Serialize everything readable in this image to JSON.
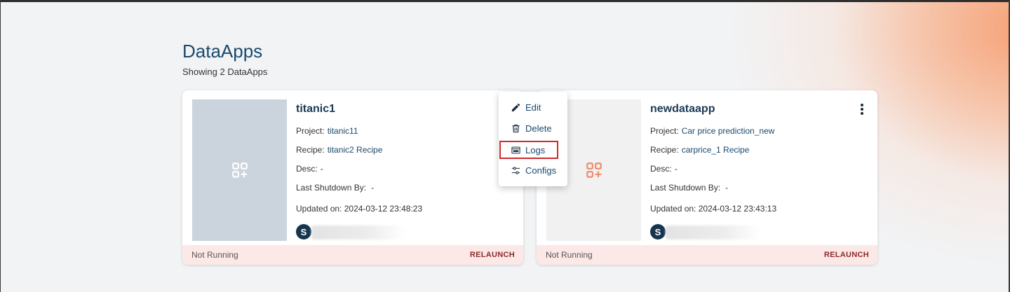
{
  "page": {
    "title": "DataApps",
    "subtitle": "Showing 2 DataApps"
  },
  "cards": [
    {
      "title": "titanic1",
      "project_label": "Project:",
      "project_value": "titanic11",
      "recipe_label": "Recipe:",
      "recipe_value": "titanic2 Recipe",
      "desc_label": "Desc:",
      "desc_value": "-",
      "shutdown_label": "Last Shutdown By:",
      "shutdown_value": "-",
      "updated": "Updated on: 2024-03-12 23:48:23",
      "avatar_letter": "S",
      "status": "Not Running",
      "action": "RELAUNCH",
      "icon": "apps-add-icon",
      "icon_color": "#ffffff"
    },
    {
      "title": "newdataapp",
      "project_label": "Project:",
      "project_value": "Car price prediction_new",
      "recipe_label": "Recipe:",
      "recipe_value": "carprice_1 Recipe",
      "desc_label": "Desc:",
      "desc_value": "-",
      "shutdown_label": "Last Shutdown By:",
      "shutdown_value": "-",
      "updated": "Updated on: 2024-03-12 23:43:13",
      "avatar_letter": "S",
      "status": "Not Running",
      "action": "RELAUNCH",
      "icon": "apps-add-icon",
      "icon_color": "#f08a6c"
    }
  ],
  "context_menu": {
    "items": [
      {
        "label": "Edit",
        "icon": "pencil-icon"
      },
      {
        "label": "Delete",
        "icon": "trash-icon"
      },
      {
        "label": "Logs",
        "icon": "logs-icon",
        "highlighted": true
      },
      {
        "label": "Configs",
        "icon": "sliders-icon"
      }
    ]
  },
  "colors": {
    "accent": "#1b4a6e",
    "footer_bg": "#fde8e8",
    "relaunch": "#8a2a2a",
    "highlight": "#d02a2a"
  }
}
